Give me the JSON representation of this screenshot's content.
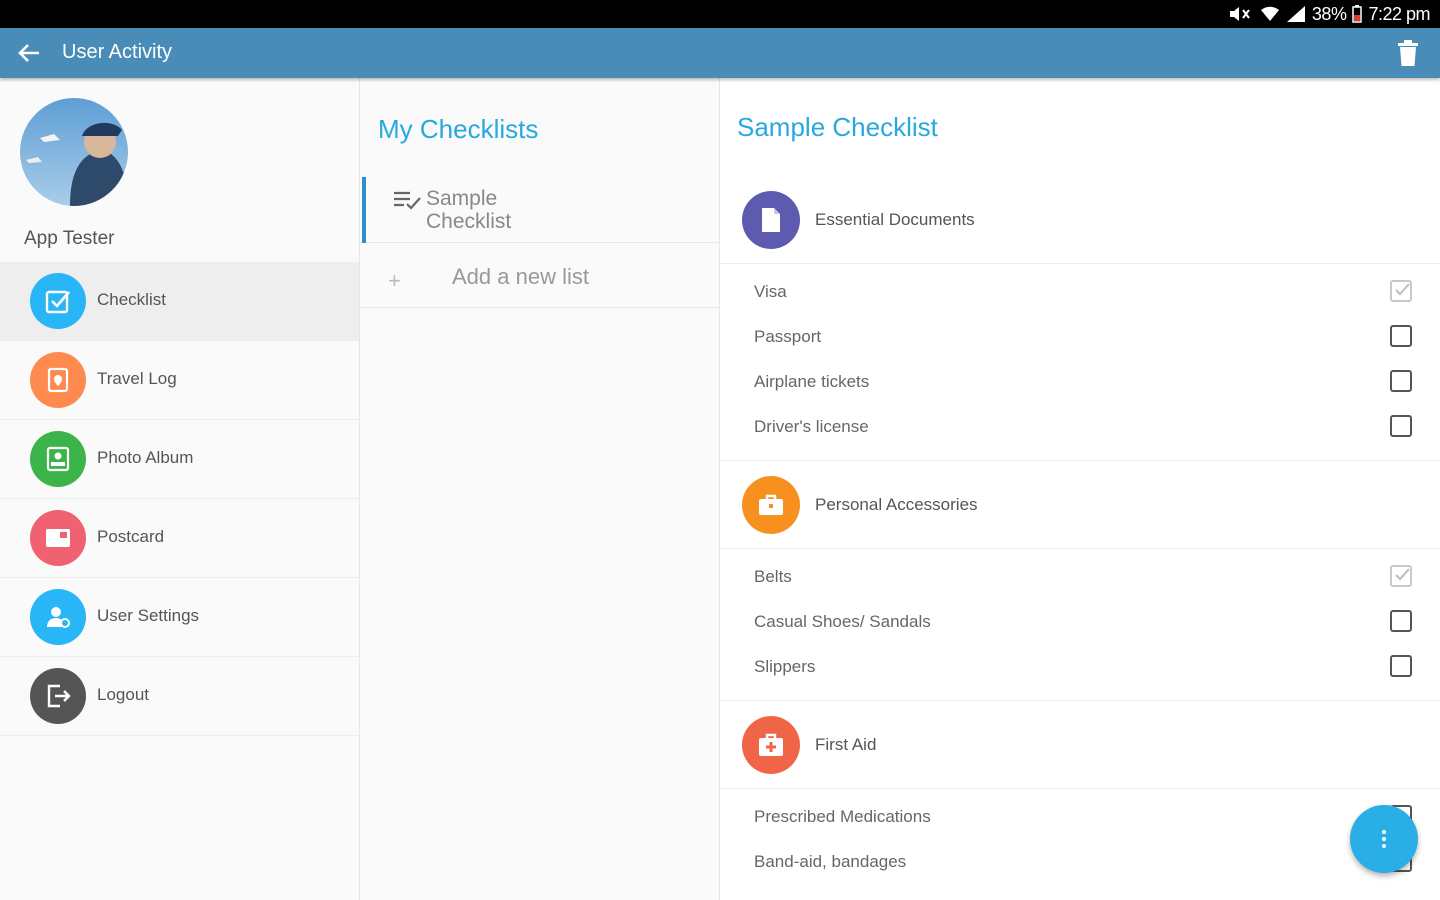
{
  "status_bar": {
    "battery": "38%",
    "time": "7:22 pm"
  },
  "app_bar": {
    "title": "User Activity"
  },
  "sidebar": {
    "user_name": "App Tester",
    "items": [
      {
        "label": "Checklist",
        "icon": "checklist-icon",
        "color": "#29b6f6",
        "active": true
      },
      {
        "label": "Travel Log",
        "icon": "travel-log-icon",
        "color": "#ff8a50"
      },
      {
        "label": "Photo Album",
        "icon": "photo-icon",
        "color": "#3db44a"
      },
      {
        "label": "Postcard",
        "icon": "postcard-icon",
        "color": "#f06272"
      },
      {
        "label": "User Settings",
        "icon": "user-settings-icon",
        "color": "#29b6f6"
      },
      {
        "label": "Logout",
        "icon": "logout-icon",
        "color": "#555555"
      }
    ]
  },
  "checklists_panel": {
    "title": "My Checklists",
    "lists": [
      {
        "label": "Sample Checklist"
      }
    ],
    "add_label": "Add a new list"
  },
  "detail": {
    "title": "Sample Checklist",
    "categories": [
      {
        "label": "Essential Documents",
        "icon": "document-icon",
        "color": "#5c5bb0",
        "items": [
          {
            "label": "Visa",
            "checked": true
          },
          {
            "label": "Passport",
            "checked": false
          },
          {
            "label": "Airplane tickets",
            "checked": false
          },
          {
            "label": "Driver's license",
            "checked": false
          }
        ]
      },
      {
        "label": "Personal Accessories",
        "icon": "briefcase-icon",
        "color": "#f7901e",
        "items": [
          {
            "label": "Belts",
            "checked": true
          },
          {
            "label": "Casual Shoes/ Sandals",
            "checked": false
          },
          {
            "label": "Slippers",
            "checked": false
          }
        ]
      },
      {
        "label": "First Aid",
        "icon": "first-aid-icon",
        "color": "#f06548",
        "items": [
          {
            "label": "Prescribed Medications",
            "checked": false
          },
          {
            "label": "Band-aid, bandages",
            "checked": false
          }
        ]
      }
    ]
  },
  "fab": {
    "icon": "more-vert-icon",
    "color": "#29aee6"
  }
}
